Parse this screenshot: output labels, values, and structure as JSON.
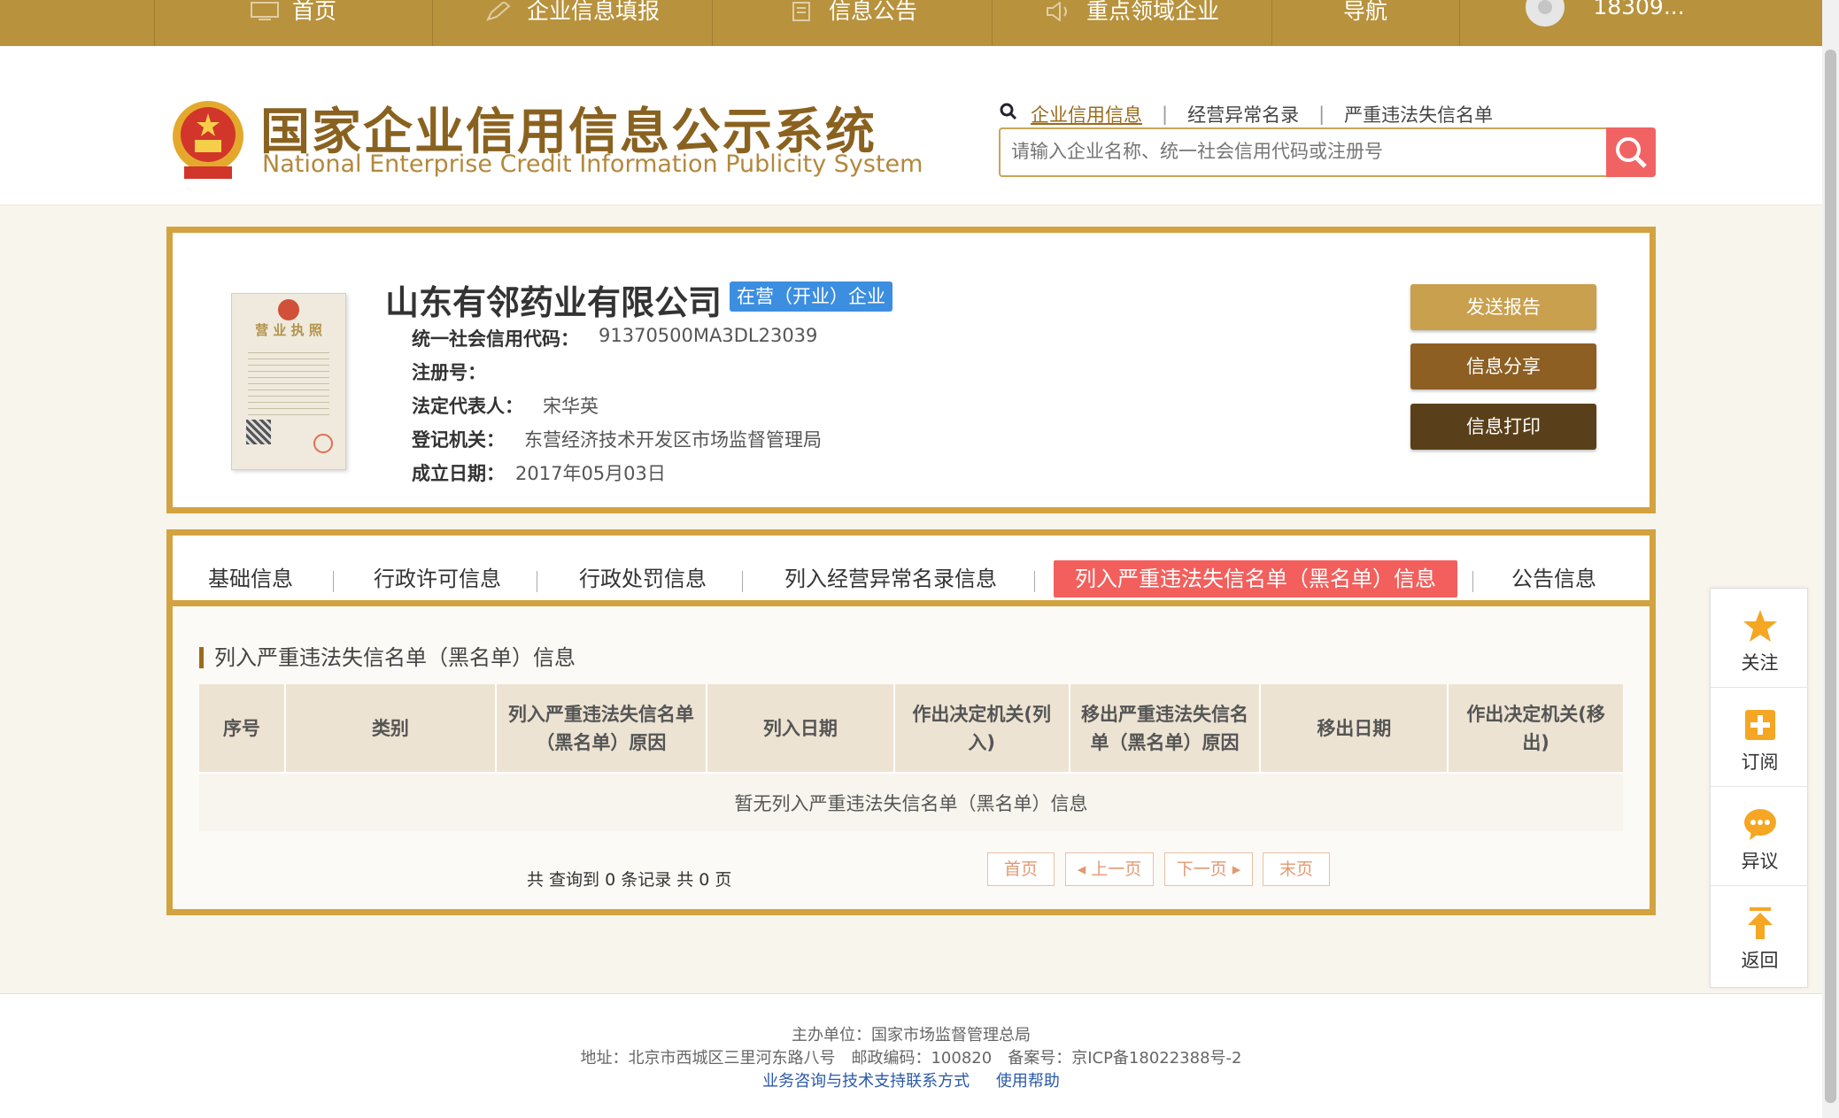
{
  "nav": {
    "items": [
      {
        "label": "首页",
        "icon": "monitor-icon"
      },
      {
        "label": "企业信息填报",
        "icon": "edit-icon"
      },
      {
        "label": "信息公告",
        "icon": "document-icon"
      },
      {
        "label": "重点领域企业",
        "icon": "speaker-icon"
      },
      {
        "label": "导航",
        "icon": ""
      }
    ],
    "user": "18309..."
  },
  "header": {
    "title_cn": "国家企业信用信息公示系统",
    "title_en": "National Enterprise Credit Information Publicity System",
    "search_tabs": [
      "企业信用信息",
      "经营异常名录",
      "严重违法失信名单"
    ],
    "search_placeholder": "请输入企业名称、统一社会信用代码或注册号"
  },
  "company": {
    "name": "山东有邻药业有限公司",
    "status": "在营（开业）企业",
    "license_title": "营 业 执 照",
    "fields": [
      {
        "key": "统一社会信用代码：",
        "value": "91370500MA3DL23039"
      },
      {
        "key": "注册号：",
        "value": ""
      },
      {
        "key": "法定代表人：",
        "value": "宋华英"
      },
      {
        "key": "登记机关：",
        "value": "东营经济技术开发区市场监督管理局"
      },
      {
        "key": "成立日期：",
        "value": "2017年05月03日"
      }
    ],
    "buttons": [
      "发送报告",
      "信息分享",
      "信息打印"
    ]
  },
  "tabs": [
    "基础信息",
    "行政许可信息",
    "行政处罚信息",
    "列入经营异常名录信息",
    "列入严重违法失信名单（黑名单）信息",
    "公告信息"
  ],
  "section": {
    "title": "列入严重违法失信名单（黑名单）信息",
    "columns": [
      "序号",
      "类别",
      "列入严重违法失信名单（黑名单）原因",
      "列入日期",
      "作出决定机关(列入)",
      "移出严重违法失信名单（黑名单）原因",
      "移出日期",
      "作出决定机关(移出)"
    ],
    "empty_text": "暂无列入严重违法失信名单（黑名单）信息",
    "pager_info": "共 查询到 0 条记录 共 0 页",
    "pager": {
      "first": "首页",
      "prev": "上一页",
      "next": "下一页",
      "last": "末页"
    }
  },
  "side": [
    "关注",
    "订阅",
    "异议",
    "返回"
  ],
  "footer": {
    "line1": "主办单位：国家市场监督管理总局",
    "line2": "地址：北京市西城区三里河东路八号　邮政编码：100820　备案号：京ICP备18022388号-2",
    "links": [
      "业务咨询与技术支持联系方式",
      "使用帮助"
    ]
  },
  "colors": {
    "gold": "#d3a341",
    "nav": "#b8923c",
    "red": "#f25f5c",
    "blue": "#3c8ee0",
    "btn1": "#c9a04e",
    "btn2": "#8d5f22",
    "btn3": "#5a401a"
  }
}
